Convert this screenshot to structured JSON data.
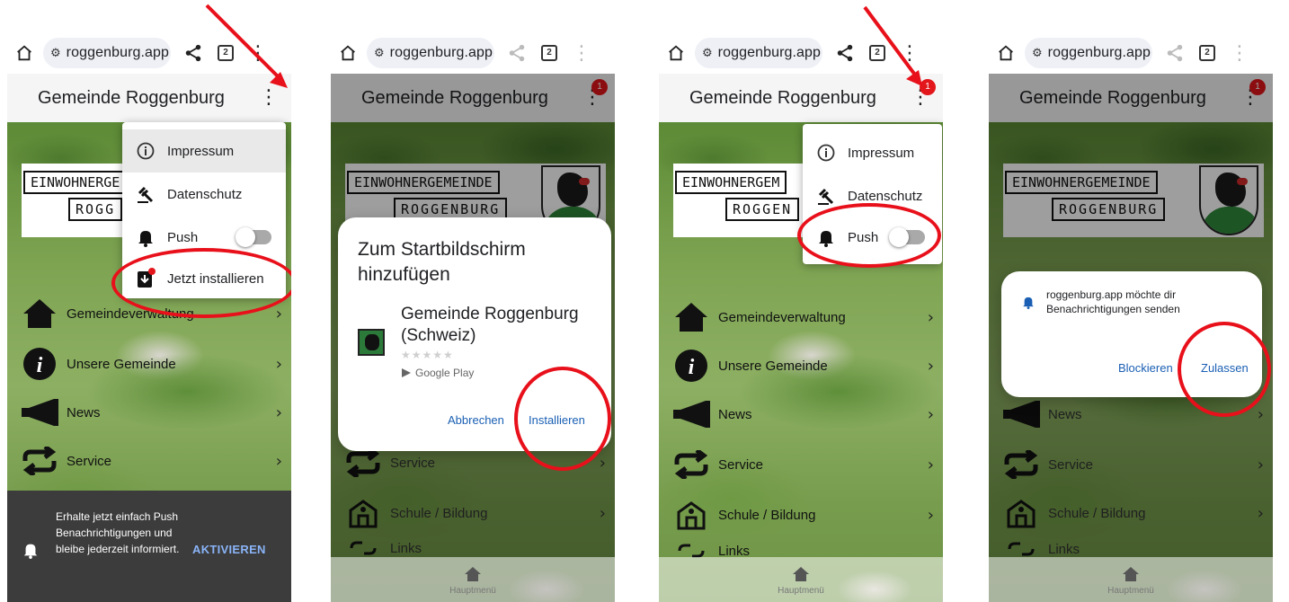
{
  "browser": {
    "host": "roggenburg.app",
    "tab_count": "2"
  },
  "app": {
    "title": "Gemeinde Roggenburg",
    "badge": "1",
    "logo_line1_full": "EINWOHNERGEMEINDE",
    "logo_line1_cut1": "EINWOHNERGE",
    "logo_line1_cut3": "EINWOHNERGEM",
    "logo_line2_full": "ROGGENBURG",
    "logo_line2_cut1": "ROGG",
    "logo_line2_cut3": "ROGGEN"
  },
  "nav": {
    "items": [
      {
        "label": "Gemeindeverwaltung",
        "icon": "home-icon"
      },
      {
        "label": "Unsere Gemeinde",
        "icon": "info-icon"
      },
      {
        "label": "News",
        "icon": "megaphone-icon"
      },
      {
        "label": "Service",
        "icon": "repeat-icon"
      },
      {
        "label": "Schule / Bildung",
        "icon": "school-icon"
      },
      {
        "label": "Links",
        "icon": "link-icon"
      }
    ],
    "bottom_label": "Hauptmenü"
  },
  "popup_menu": {
    "impressum": "Impressum",
    "datenschutz": "Datenschutz",
    "push": "Push",
    "install": "Jetzt installieren"
  },
  "banner": {
    "text": "Erhalte jetzt einfach Push Benachrichtigungen und bleibe jederzeit informiert.",
    "button": "AKTIVIEREN"
  },
  "install_dialog": {
    "title": "Zum Startbildschirm hinzufügen",
    "app_name": "Gemeinde Roggenburg (Schweiz)",
    "store": "Google Play",
    "rating_stars": "★★★★★",
    "cancel": "Abbrechen",
    "install": "Installieren"
  },
  "permission_dialog": {
    "message": "roggenburg.app möchte dir Benachrichtigungen senden",
    "block": "Blockieren",
    "allow": "Zulassen"
  },
  "colors": {
    "annotation_red": "#e8101a",
    "link_blue": "#1a5fb4",
    "banner_bg": "#3c3c3c",
    "banner_button": "#8ab4f8"
  }
}
